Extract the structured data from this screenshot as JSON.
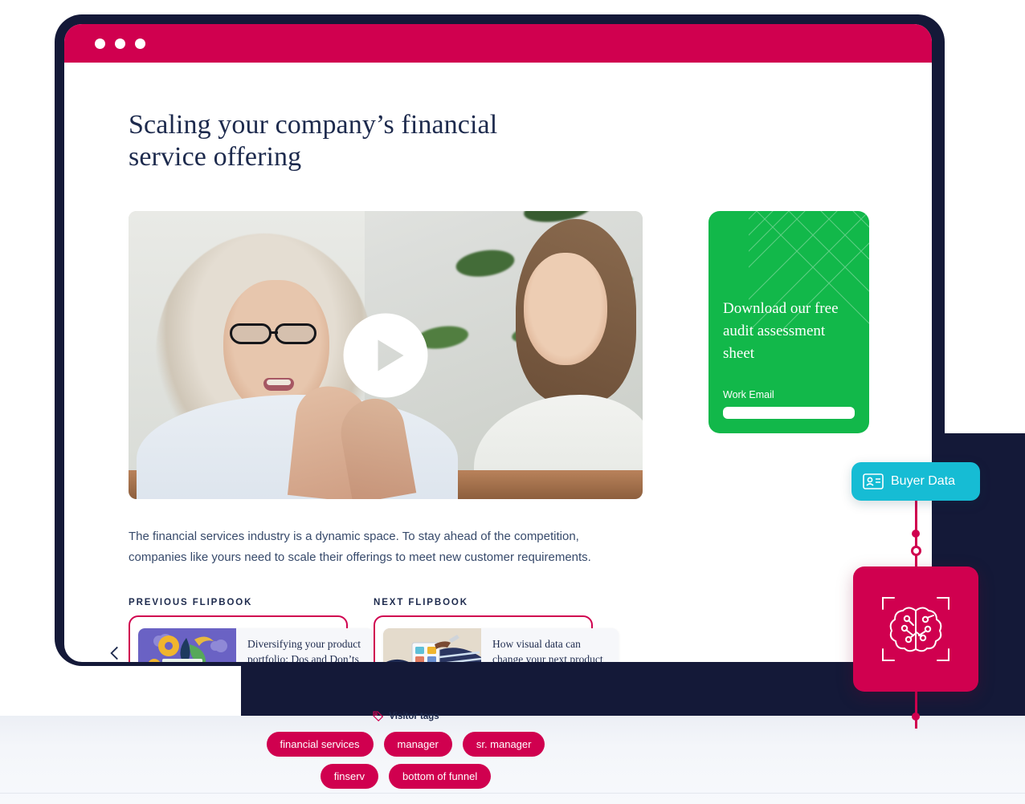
{
  "window": {
    "dots": [
      "minimize-dot",
      "maximize-dot",
      "close-dot"
    ],
    "titlebar_color": "#d0004f"
  },
  "page": {
    "title": "Scaling your company’s financial service offering",
    "paragraph": "The financial services industry is a dynamic space. To stay ahead of the competition, companies like yours need to scale their offerings to meet new customer requirements."
  },
  "video": {
    "play_label": "play-video",
    "alt": "Woman in glasses speaking with colleague in office"
  },
  "cta_card": {
    "title": "Download our free audit assessment sheet",
    "email_label": "Work Email",
    "email_value": "",
    "email_placeholder": "",
    "background_color": "#12b84a"
  },
  "flipbooks": {
    "previous": {
      "kicker": "PREVIOUS FLIPBOOK",
      "title": "Diversifying your product portfolio: Dos and Don’ts",
      "thumb": "illustration-books-gears"
    },
    "next": {
      "kicker": "NEXT FLIPBOOK",
      "title": "How visual data can change your next product campaign",
      "thumb": "photo-person-tablet"
    },
    "prev_arrow": "chevron-left-icon",
    "next_arrow": "chevron-right-icon"
  },
  "widgets": {
    "buyer_chip": {
      "label": "Buyer Data",
      "icon": "id-card-icon",
      "color": "#16bcd4"
    },
    "brain_card": {
      "icon": "ai-brain-scan-icon",
      "color": "#d0004f"
    }
  },
  "visitor_tags": {
    "heading": "Visitor tags",
    "icon": "tag-icon",
    "rows": [
      [
        "financial services",
        "manager",
        "sr. manager"
      ],
      [
        "finserv",
        "bottom of funnel"
      ]
    ]
  },
  "colors": {
    "brand_pink": "#d0004f",
    "navy": "#1d2a4d",
    "green": "#12b84a",
    "cyan": "#16bcd4"
  }
}
